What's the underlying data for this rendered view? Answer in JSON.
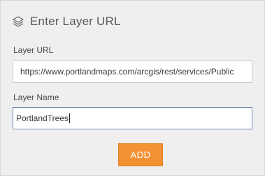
{
  "header": {
    "icon": "layers-icon",
    "title": "Enter Layer URL"
  },
  "form": {
    "url_label": "Layer URL",
    "url_value": "https://www.portlandmaps.com/arcgis/rest/services/Public",
    "name_label": "Layer Name",
    "name_value": "PortlandTrees"
  },
  "actions": {
    "add_label": "ADD"
  },
  "colors": {
    "accent": "#f29234",
    "panel_bg": "#efefef",
    "focus_border": "#6e86b0"
  }
}
